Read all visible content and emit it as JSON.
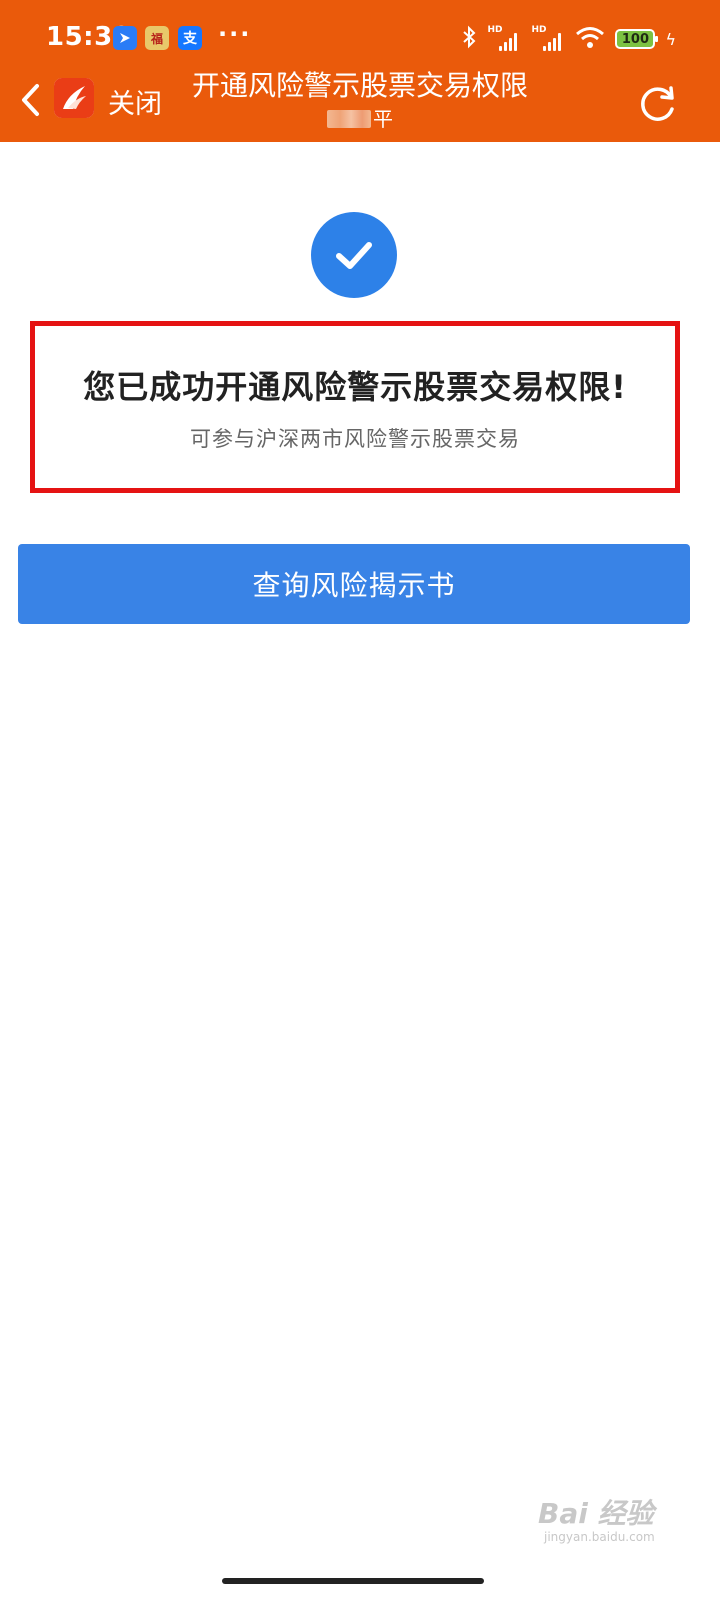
{
  "status_bar": {
    "time": "15:39",
    "notification_icons": [
      "feishu-icon",
      "fuli-app-icon",
      "alipay-icon"
    ],
    "app_icon_labels": {
      "fuli": "福",
      "alipay": "支"
    },
    "more": "···",
    "signal_label": "HD",
    "battery": "100",
    "bluetooth": "✱",
    "charging": "ϟ"
  },
  "nav": {
    "close_label": "关闭",
    "title": "开通风险警示股票交易权限",
    "subtitle_suffix": "平"
  },
  "result": {
    "title": "您已成功开通风险警示股票交易权限!",
    "description": "可参与沪深两市风险警示股票交易"
  },
  "actions": {
    "view_disclosure_label": "查询风险揭示书"
  },
  "watermark": {
    "main": "Bai 经验",
    "sub": "jingyan.baidu.com"
  },
  "colors": {
    "header_bg": "#ea5a0b",
    "primary": "#3983e6",
    "success_icon": "#2d81e8",
    "highlight_border": "#e51313"
  }
}
